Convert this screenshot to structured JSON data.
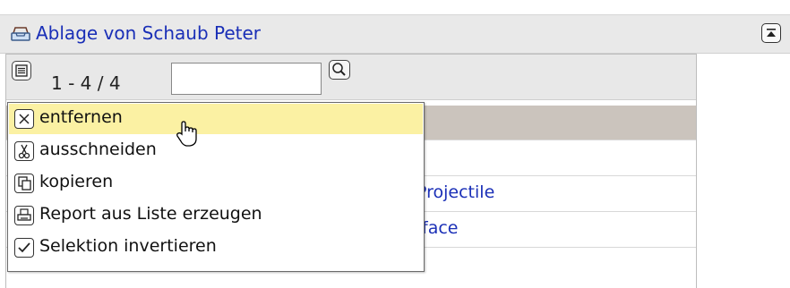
{
  "header": {
    "title": "Ablage von Schaub Peter"
  },
  "toolbar": {
    "count": "1 - 4 / 4",
    "search_value": ""
  },
  "rows": [
    {
      "text": "Projectile"
    },
    {
      "text": "face"
    }
  ],
  "menu": {
    "items": [
      {
        "label": "entfernen",
        "icon": "x-box-icon",
        "highlighted": true
      },
      {
        "label": "ausschneiden",
        "icon": "scissors-icon"
      },
      {
        "label": "kopieren",
        "icon": "copy-icon"
      },
      {
        "label": "Report aus Liste erzeugen",
        "icon": "printer-icon"
      },
      {
        "label": "Selektion invertieren",
        "icon": "checkmark-icon"
      }
    ]
  },
  "colors": {
    "link": "#1a2fb7",
    "highlight": "#fbf1a3",
    "selected_row": "#cbc4bd"
  }
}
